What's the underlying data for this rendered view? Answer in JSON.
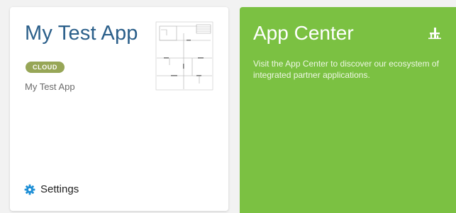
{
  "app_card": {
    "title": "My Test App",
    "badge": "CLOUD",
    "subtitle": "My Test App",
    "thumbnail_icon": "floorplan-thumbnail",
    "settings_icon": "gear-icon",
    "settings_label": "Settings",
    "colors": {
      "title": "#2b5f8a",
      "badge": "#97a657",
      "settings_icon": "#1e8fd6"
    }
  },
  "app_center": {
    "title": "App Center",
    "icon": "app-center-icon",
    "description": "Visit the App Center to discover our ecosystem of integrated partner applications.",
    "colors": {
      "background": "#7bc142",
      "text": "#ffffff"
    }
  }
}
